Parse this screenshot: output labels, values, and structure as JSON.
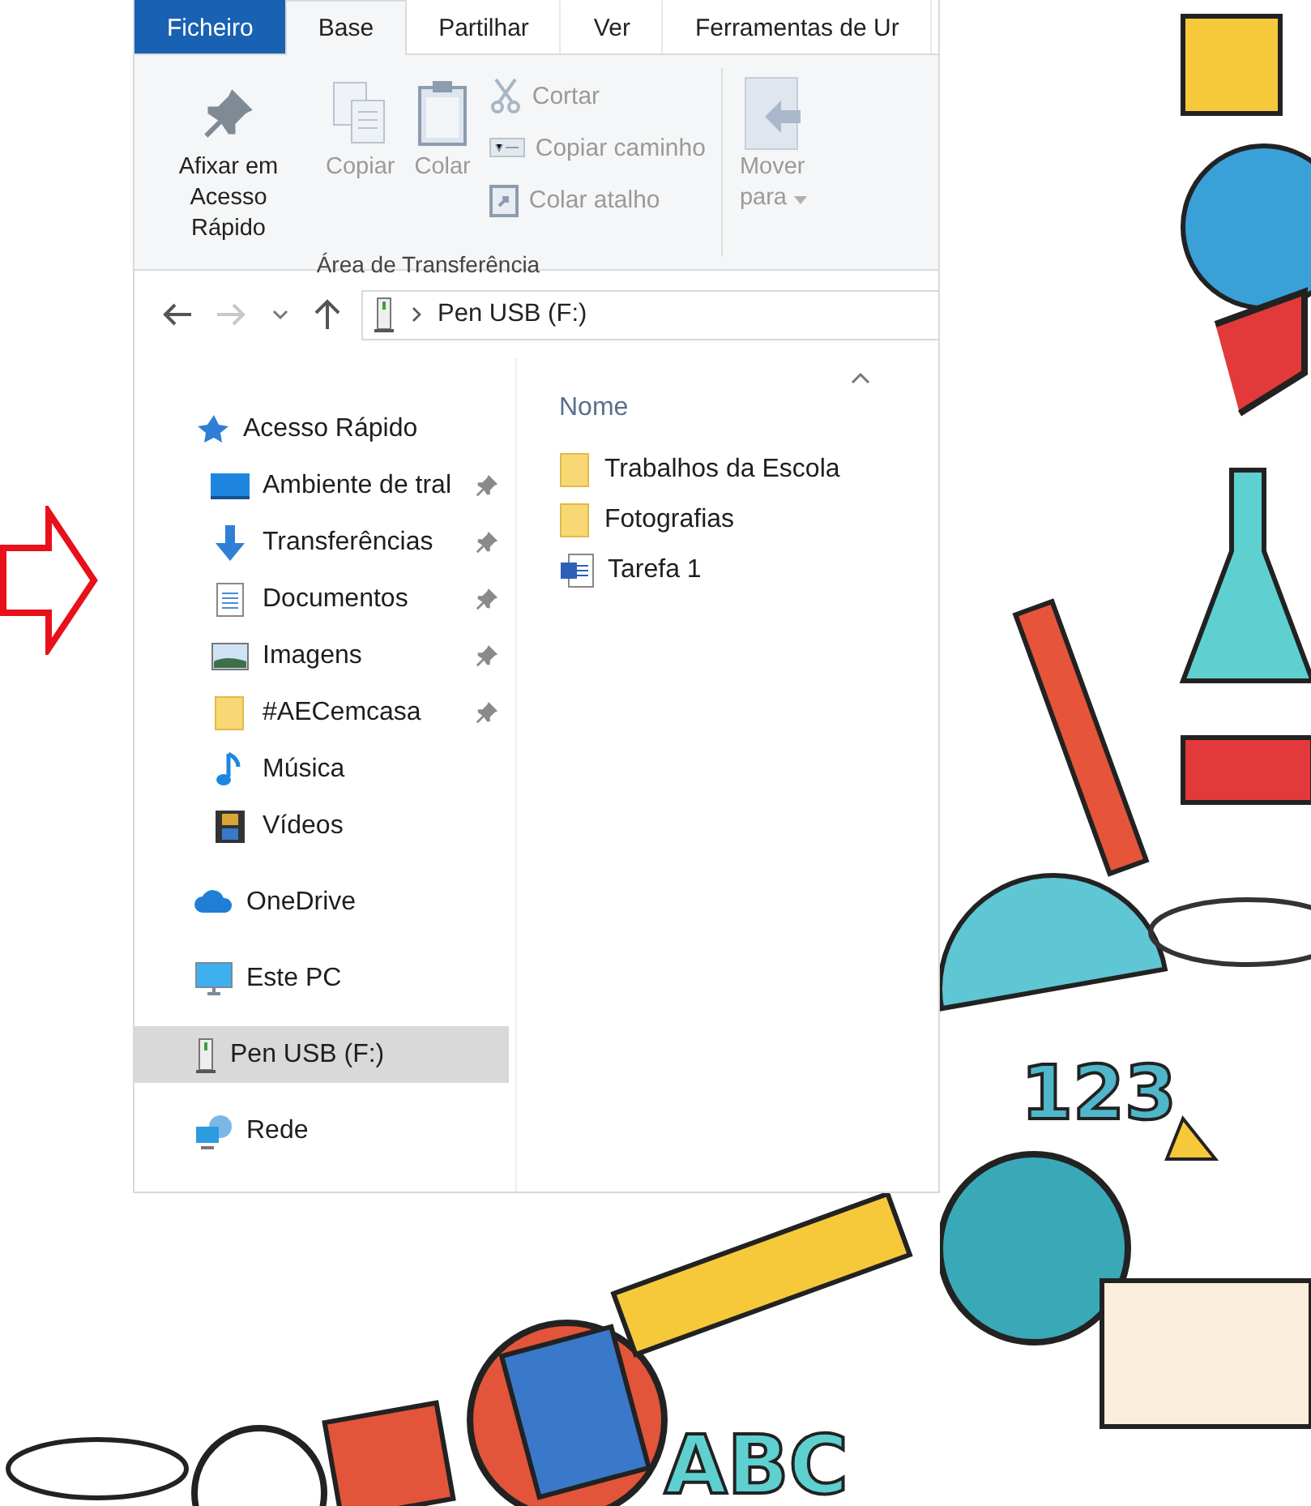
{
  "ribbon_tabs": [
    {
      "label": "Ficheiro",
      "kind": "file",
      "selected": false
    },
    {
      "label": "Base",
      "kind": "tab",
      "selected": true
    },
    {
      "label": "Partilhar",
      "kind": "tab",
      "selected": false
    },
    {
      "label": "Ver",
      "kind": "tab",
      "selected": false
    },
    {
      "label": "Ferramentas de Ur",
      "kind": "tab",
      "selected": false
    }
  ],
  "ribbon": {
    "clipboard_group": {
      "label": "Área de Transferência",
      "large_buttons": [
        {
          "label": "Afixar em Acesso Rápido",
          "disabled": false
        },
        {
          "label": "Copiar",
          "disabled": true
        },
        {
          "label": "Colar",
          "disabled": true
        }
      ],
      "small_buttons": [
        {
          "label": "Cortar",
          "disabled": true
        },
        {
          "label": "Copiar caminho",
          "disabled": true
        },
        {
          "label": "Colar atalho",
          "disabled": true
        }
      ]
    },
    "organize_group": {
      "buttons": [
        {
          "label": "Mover para",
          "disabled": true
        }
      ]
    }
  },
  "navigation": {
    "back_disabled": false,
    "forward_disabled": true,
    "path": "Pen USB (F:)"
  },
  "nav_pane": [
    {
      "label": "Acesso Rápido",
      "selected": false,
      "children": [
        {
          "label": "Ambiente de tral",
          "pinned": true,
          "selected": false
        },
        {
          "label": "Transferências",
          "pinned": true,
          "selected": false
        },
        {
          "label": "Documentos",
          "pinned": true,
          "selected": false
        },
        {
          "label": "Imagens",
          "pinned": true,
          "selected": false
        },
        {
          "label": "#AECemcasa",
          "pinned": true,
          "selected": false
        },
        {
          "label": "Música",
          "pinned": false,
          "selected": false
        },
        {
          "label": "Vídeos",
          "pinned": false,
          "selected": false
        }
      ]
    },
    {
      "label": "OneDrive",
      "selected": false
    },
    {
      "label": "Este PC",
      "selected": false
    },
    {
      "label": "Pen USB (F:)",
      "selected": true
    },
    {
      "label": "Rede",
      "selected": false
    }
  ],
  "file_list": {
    "column": "Nome",
    "items": [
      {
        "name": "Trabalhos da Escola",
        "kind": "folder"
      },
      {
        "name": "Fotografias",
        "kind": "folder"
      },
      {
        "name": "Tarefa 1",
        "kind": "word"
      }
    ]
  },
  "decoration_labels": [
    "123",
    "ABC"
  ]
}
